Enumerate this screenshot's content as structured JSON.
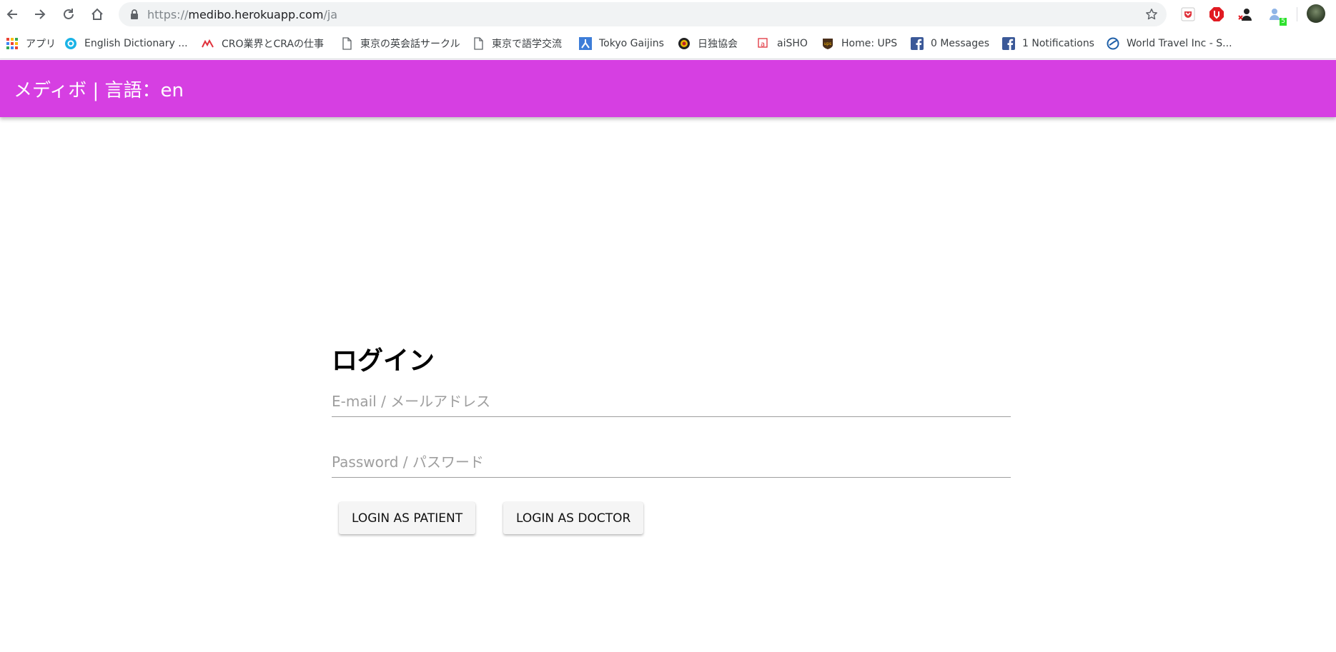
{
  "browser": {
    "url_scheme": "https://",
    "url_host": "medibo.herokuapp.com",
    "url_path": "/ja",
    "extension_badge": "5"
  },
  "bookmarks": [
    {
      "label": "アプリ",
      "icon": "apps-grid-icon"
    },
    {
      "label": "English Dictionary ...",
      "icon": "dictionary-icon"
    },
    {
      "label": "CRO業界とCRAの仕事",
      "icon": "cro-logo-icon"
    },
    {
      "label": "東京の英会話サークル",
      "icon": "page-icon"
    },
    {
      "label": "東京で語学交流",
      "icon": "page-icon"
    },
    {
      "label": "Tokyo Gaijins",
      "icon": "tokyo-gaijins-icon"
    },
    {
      "label": "日独協会",
      "icon": "emblem-icon"
    },
    {
      "label": "aiSHO",
      "icon": "aisho-icon"
    },
    {
      "label": "Home: UPS",
      "icon": "ups-icon"
    },
    {
      "label": "0 Messages",
      "icon": "facebook-icon"
    },
    {
      "label": "1 Notifications",
      "icon": "facebook-icon"
    },
    {
      "label": "World Travel Inc - S...",
      "icon": "world-travel-icon"
    }
  ],
  "app": {
    "title": "メディボ | 言語：en",
    "accent_color": "#d63fe2"
  },
  "login": {
    "heading": "ログイン",
    "email_placeholder": "E-mail / メールアドレス",
    "email_value": "",
    "password_placeholder": "Password / パスワード",
    "password_value": "",
    "patient_button": "LOGIN AS PATIENT",
    "doctor_button": "LOGIN AS DOCTOR"
  }
}
